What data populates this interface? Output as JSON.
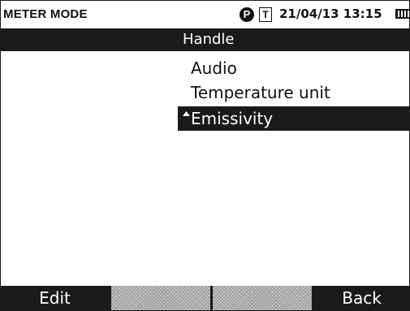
{
  "status_bar": {
    "mode": "METER MODE",
    "p_indicator": "P",
    "t_indicator": "T",
    "datetime": "21/04/13 13:15",
    "battery_icon": "battery-icon"
  },
  "title": "Handle",
  "menu": {
    "items": [
      {
        "label": "Audio",
        "selected": false
      },
      {
        "label": "Temperature unit",
        "selected": false
      },
      {
        "label": "Emissivity",
        "selected": true,
        "icon": "caret-up-icon"
      }
    ]
  },
  "softkeys": [
    {
      "label": "Edit"
    },
    {
      "label": ""
    },
    {
      "label": ""
    },
    {
      "label": "Back"
    }
  ],
  "colors": {
    "foreground": "#1a1a1a",
    "background": "#ffffff",
    "highlight_text": "#ffffff"
  }
}
